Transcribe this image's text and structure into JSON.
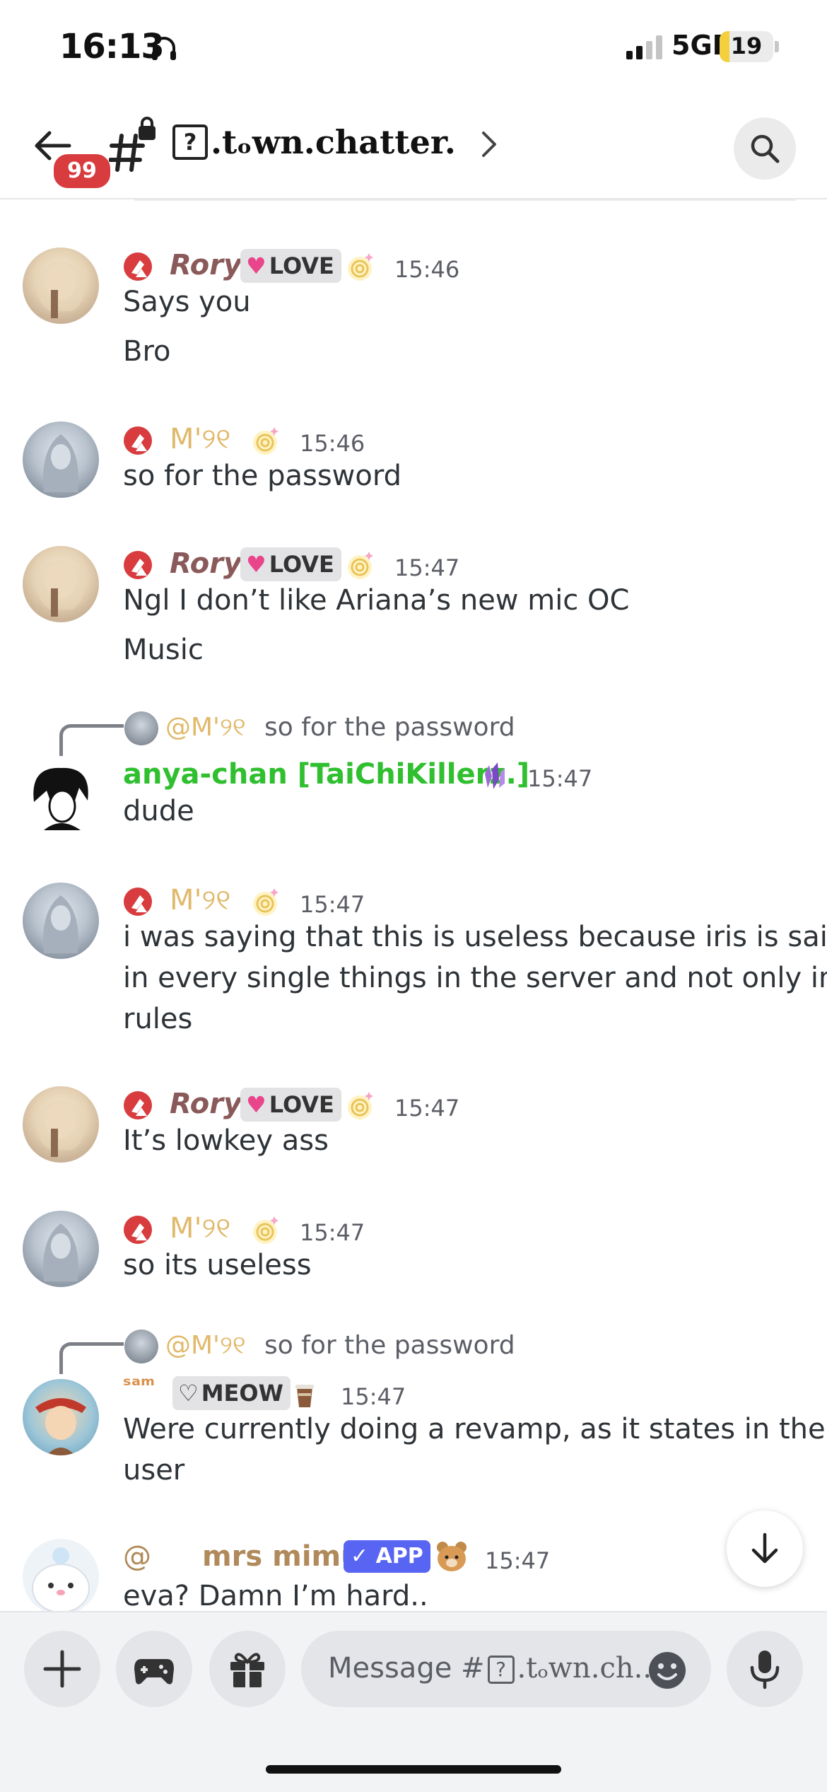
{
  "status_bar": {
    "time": "16:13",
    "network": "5GE",
    "battery": "19",
    "battery_level": 0.19
  },
  "header": {
    "unread_count": "99",
    "channel_icon": "?",
    "channel_name": ".tₒwn.chatter.",
    "colors": {
      "badge": "#d83c3e"
    }
  },
  "messages": [
    {
      "author": "Rory",
      "tag": "LOVE",
      "time": "15:46",
      "lines": [
        "Says you",
        "Bro"
      ]
    },
    {
      "author": "M'୨୧",
      "time": "15:46",
      "lines": [
        "so for the password"
      ]
    },
    {
      "author": "Rory",
      "tag": "LOVE",
      "time": "15:47",
      "lines": [
        "Ngl I don’t like Ariana’s new mic OC",
        "Music"
      ]
    },
    {
      "reply_to": "@M'୨୧",
      "reply_text": "so for the password",
      "author": "anya-chan [TaiChiKillerz.]",
      "time": "15:47",
      "lines": [
        "dude"
      ]
    },
    {
      "author": "M'୨୧",
      "time": "15:47",
      "lines": [
        "i was saying that this is useless because iris is said",
        "in every single things in the server and not only in",
        "rules"
      ]
    },
    {
      "author": "Rory",
      "tag": "LOVE",
      "time": "15:47",
      "lines": [
        "It’s lowkey ass"
      ]
    },
    {
      "author": "M'୨୧",
      "time": "15:47",
      "lines": [
        "so its useless"
      ]
    },
    {
      "reply_to": "@M'୨୧",
      "reply_text": "so for the password",
      "author": "ˢᵃᵐ",
      "tag": "MEOW",
      "time": "15:47",
      "lines": [
        "Were currently doing a revamp, as it states in the",
        "user"
      ]
    },
    {
      "author_prefix": "@",
      "author": "mrs mimu",
      "tag": "APP",
      "time": "15:47",
      "lines": [
        "eva? Damn I’m hard.."
      ]
    }
  ],
  "composer": {
    "placeholder": "Message #",
    "placeholder_icon": "?",
    "placeholder_channel": ".tₒwn.ch..."
  },
  "colors": {
    "rory": "#8a5a5a",
    "m": "#e0b96a",
    "anya": "#2fbf2f",
    "sam": "#d9904a",
    "mimu": "#b08a5a",
    "app_tag": "#5865f2"
  }
}
